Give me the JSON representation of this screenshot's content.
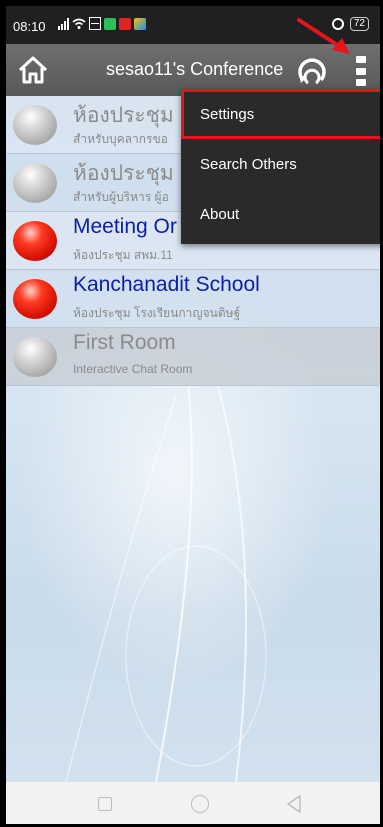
{
  "status_bar": {
    "time": "08:10",
    "battery": "72",
    "icons": [
      "signal-icon",
      "wifi-icon",
      "volte-icon",
      "app-notification-icon",
      "youtube-icon",
      "other-app-icon",
      "alarm-icon",
      "battery-icon"
    ]
  },
  "header": {
    "title": "sesao11's Conference",
    "home_icon": "home-icon",
    "refresh_icon": "refresh-icon",
    "menu_icon": "overflow-menu-icon"
  },
  "rooms": [
    {
      "name": "ห้องประชุม",
      "subtitle": "สำหรับบุคลากรขอ",
      "status": "gray"
    },
    {
      "name": "ห้องประชุม",
      "subtitle": "สำหรับผู้บริหาร ผู้อ",
      "status": "gray"
    },
    {
      "name": "Meeting Or",
      "subtitle": "ห้องประชุม สพม.11",
      "status": "red"
    },
    {
      "name": "Kanchanadit School",
      "subtitle": "ห้องประชุม โรงเรียนกาญจนดิษฐ์",
      "status": "red"
    },
    {
      "name": "First Room",
      "subtitle": "Interactive Chat Room",
      "status": "gray"
    }
  ],
  "menu": {
    "items": [
      "Settings",
      "Search Others",
      "About"
    ]
  },
  "annotation": {
    "arrow_color": "#e8141c",
    "highlight_color": "#e8141c"
  },
  "nav_bar": {
    "icons": [
      "recent-apps-icon",
      "home-nav-icon",
      "back-icon"
    ]
  }
}
